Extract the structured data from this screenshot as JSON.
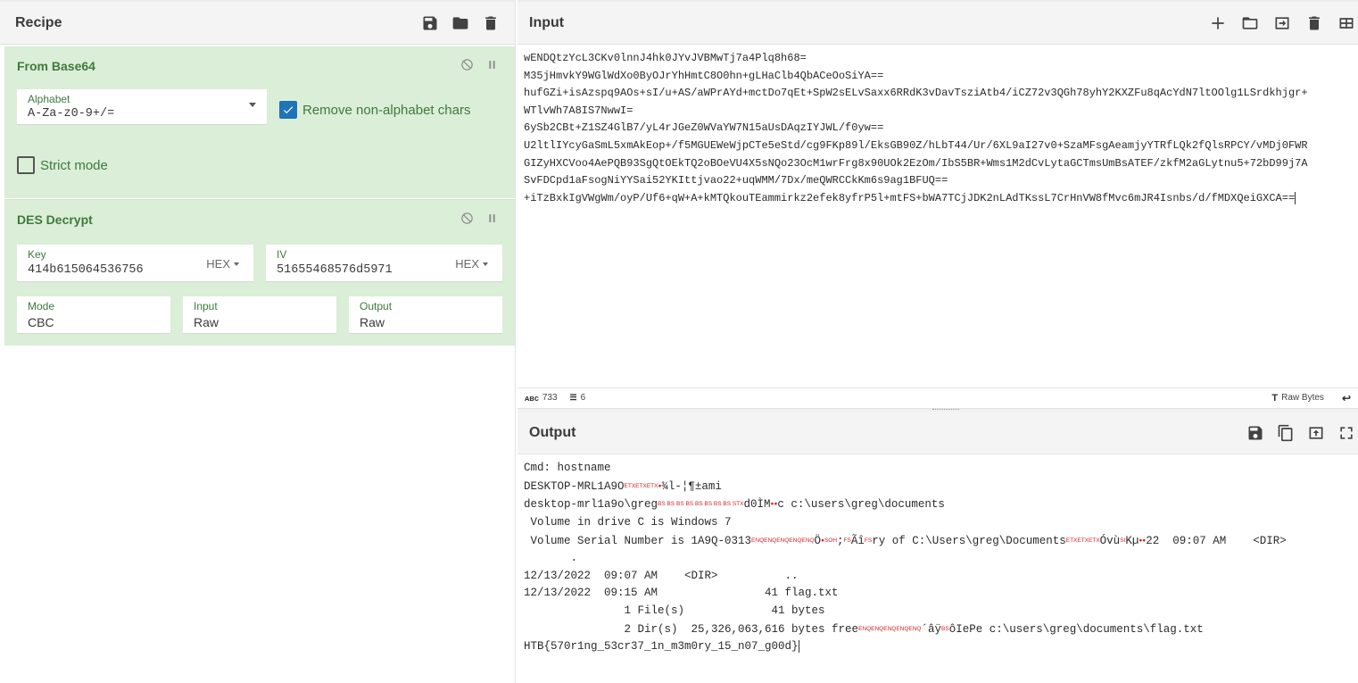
{
  "recipe": {
    "title": "Recipe",
    "operations": {
      "from_base64": {
        "title": "From Base64",
        "alphabet_label": "Alphabet",
        "alphabet_value": "A-Za-z0-9+/=",
        "remove_label": "Remove non-alphabet chars",
        "strict_label": "Strict mode"
      },
      "des_decrypt": {
        "title": "DES Decrypt",
        "key_label": "Key",
        "key_value": "414b615064536756",
        "key_format": "HEX",
        "iv_label": "IV",
        "iv_value": "51655468576d5971",
        "iv_format": "HEX",
        "mode_label": "Mode",
        "mode_value": "CBC",
        "input_label": "Input",
        "input_value": "Raw",
        "output_label": "Output",
        "output_value": "Raw"
      }
    }
  },
  "input": {
    "title": "Input",
    "lines": [
      "wENDQtzYcL3CKv0lnnJ4hk0JYvJVBMwTj7a4Plq8h68=",
      "M35jHmvkY9WGlWdXo0ByOJrYhHmtC8O0hn+gLHaClb4QbACeOoSiYA==",
      "hufGZi+isAzspq9AOs+sI/u+AS/aWPrAYd+mctDo7qEt+SpW2sELvSaxx6RRdK3vDavTsziAtb4/iCZ72v3QGh78yhY2KXZFu8qAcYdN7ltOOlg1LSrdkhjgr+",
      "WTlvWh7A8IS7NwwI=",
      "6ySb2CBt+Z1SZ4GlB7/yL4rJGeZ0WVaYW7N15aUsDAqzIYJWL/f0yw==",
      "U2ltlIYcyGaSmL5xmAkEop+/f5MGUEWeWjpCTe5eStd/cg9FKp89l/EksGB90Z/hLbT44/Ur/6XL9aI27v0+SzaMFsgAeamjyYTRfLQk2fQlsRPCY/vMDj0FWR",
      "GIZyHXCVoo4AePQB93SgQtOEkTQ2oBOeVU4X5sNQo23OcM1wrFrg8x90UOk2EzOm/IbS5BR+Wms1M2dCvLytaGCTmsUmBsATEF/zkfM2aGLytnu5+72bD99j7A",
      "SvFDCpd1aFsogNiYYSai52YKIttjvao22+uqWMM/7Dx/meQWRCCkKm6s9ag1BFUQ==",
      "+iTzBxkIgVWgWm/oyP/Uf6+qW+A+kMTQkouTEammirkz2efek8yfrP5l+mtFS+bWA7TCjJDK2nLAdTKssL7CrHnVW8fMvc6mJR4Isnbs/d/fMDXQeiGXCA=="
    ],
    "chars": "733",
    "line_count": "6",
    "encoding": "Raw Bytes"
  },
  "output": {
    "title": "Output",
    "cmd_line": "Cmd: hostname",
    "host_prefix": "DESKTOP-MRL1A9O",
    "host_ctl": "ETXETXETX",
    "host_suffix": "¾l-¦¶±ami",
    "prompt_prefix": "desktop-mrl1a9o\\greg",
    "prompt_ctl": "BS BS BS BS BS BS BS BS STX",
    "prompt_mid": "d0ÌM",
    "prompt_suffix": "c c:\\users\\greg\\documents",
    "volume_line": " Volume in drive C is Windows 7",
    "serial_prefix": " Volume Serial Number is 1A9Q-0313",
    "serial_ctl1": "ENQENQENQENQENQ",
    "serial_mid1": "Ö",
    "serial_ctl2": "SOH",
    "serial_mid2": ";",
    "serial_ctl3": "FS",
    "serial_mid3": "Ãî",
    "serial_ctl4": "FS",
    "serial_mid4": "ry of C:\\Users\\greg\\Documents",
    "serial_ctl5": "ETXETXETX",
    "serial_mid5": "Óvù",
    "serial_ctl6": "SI",
    "serial_mid6": "Kµ",
    "serial_suffix": "22  09:07 AM    <DIR>",
    "dot_line": "       .",
    "dir_line1": "12/13/2022  09:07 AM    <DIR>          ..",
    "dir_line2": "12/13/2022  09:15 AM                41 flag.txt",
    "files_line": "               1 File(s)             41 bytes",
    "dirs_prefix": "               2 Dir(s)  25,326,063,616 bytes free",
    "dirs_ctl1": "ENQENQENQENQENQ",
    "dirs_mid1": "´âÿ",
    "dirs_ctl2": "BS",
    "dirs_suffix": "ôIePe c:\\users\\greg\\documents\\flag.txt",
    "flag_line": "HTB{570r1ng_53cr37_1n_m3m0ry_15_n07_g00d}"
  },
  "colors": {
    "operation_bg": "#dbeed8",
    "operation_title": "#3f7a3d",
    "checkbox_on": "#1f73b7",
    "control_char": "#d62020"
  }
}
